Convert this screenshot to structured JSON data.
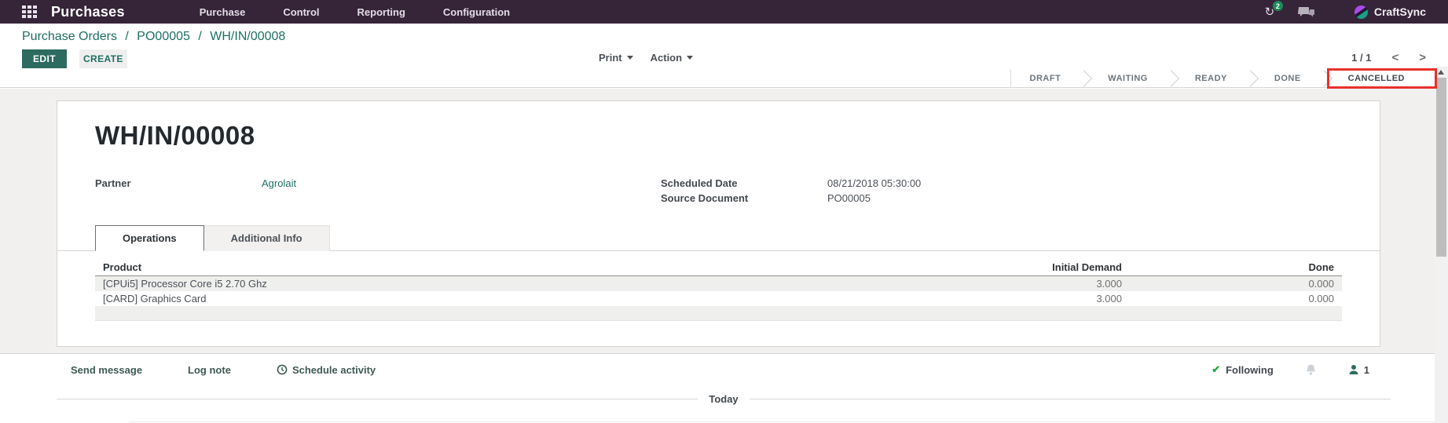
{
  "nav": {
    "app_name": "Purchases",
    "menus": [
      "Purchase",
      "Control",
      "Reporting",
      "Configuration"
    ],
    "activity_badge": "2",
    "user_name": "CraftSync"
  },
  "control_panel": {
    "breadcrumbs": [
      "Purchase Orders",
      "PO00005",
      "WH/IN/00008"
    ],
    "separator": "/",
    "edit_label": "EDIT",
    "create_label": "CREATE",
    "print_label": "Print",
    "action_label": "Action",
    "pager_count": "1 / 1",
    "pager_prev": "<",
    "pager_next": ">"
  },
  "statusbar": {
    "stages": [
      "DRAFT",
      "WAITING",
      "READY",
      "DONE",
      "CANCELLED"
    ],
    "active_stage": "CANCELLED"
  },
  "sheet": {
    "title": "WH/IN/00008",
    "partner_label": "Partner",
    "partner_value": "Agrolait",
    "scheduled_date_label": "Scheduled Date",
    "scheduled_date_value": "08/21/2018 05:30:00",
    "source_document_label": "Source Document",
    "source_document_value": "PO00005",
    "tabs": [
      "Operations",
      "Additional Info"
    ],
    "active_tab": "Operations",
    "table": {
      "columns": [
        "Product",
        "Initial Demand",
        "Done"
      ],
      "rows": [
        {
          "product": "[CPUi5] Processor Core i5 2.70 Ghz",
          "initial_demand": "3.000",
          "done": "0.000"
        },
        {
          "product": "[CARD] Graphics Card",
          "initial_demand": "3.000",
          "done": "0.000"
        }
      ]
    }
  },
  "chatter": {
    "buttons": [
      "Send message",
      "Log note",
      "Schedule activity"
    ],
    "following_label": "Following",
    "follower_count": "1",
    "date_divider": "Today"
  },
  "colors": {
    "navbar": "#362439",
    "accent_teal": "#2d6b60",
    "link_teal": "#1e6f63",
    "highlight_red": "#e8312a",
    "following_check_green": "#28a745",
    "activity_badge_green": "#1e8a5a"
  }
}
